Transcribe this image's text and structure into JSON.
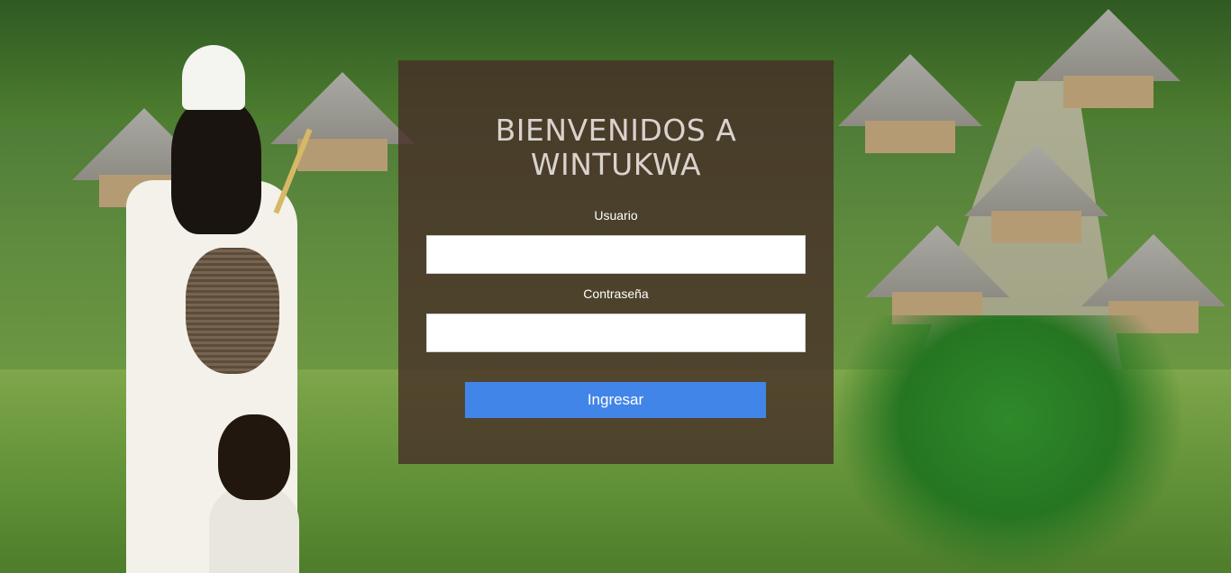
{
  "login": {
    "title_line1": "BIENVENIDOS A",
    "title_line2": "WINTUKWA",
    "username_label": "Usuario",
    "username_value": "",
    "password_label": "Contraseña",
    "password_value": "",
    "submit_label": "Ingresar"
  },
  "colors": {
    "panel_overlay": "#462c26",
    "button": "#4285e8",
    "title_text": "#d9d2cd"
  }
}
